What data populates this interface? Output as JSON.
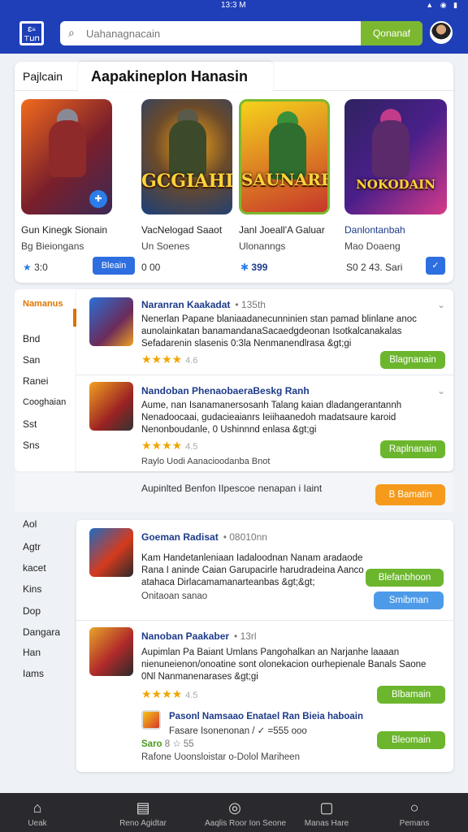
{
  "status_bar": {
    "time": "13:3 M",
    "icons": "signal wifi battery"
  },
  "header": {
    "logo_text": "Ɛ≡ ⊤⊔⊓",
    "search_placeholder": "Uahanagnacain",
    "search_button": "Qonanaf",
    "colors": {
      "bar": "#1f3fb8",
      "search_button": "#7cb82f"
    }
  },
  "featured": {
    "tab_label": "Pajlcain",
    "title": "AapakinepIon Hanasin",
    "cards": [
      {
        "art_text": "",
        "name": "Gun Kinegk Sionain",
        "sub": "Bg Bieiongans",
        "foot": "3:0",
        "action": "Bleain",
        "art_colors": [
          "#f26b1d",
          "#7a1f2b",
          "#3b2a55"
        ]
      },
      {
        "art_text": "GCGIAHI",
        "name": "VacNelogad Saaot",
        "sub": "Un Soenes",
        "foot": "0 00",
        "action": "",
        "art_colors": [
          "#1b3f7a",
          "#f0a21a",
          "#6b4a2a"
        ]
      },
      {
        "art_text": "SAUNARES",
        "name": "Janl Joeall'A Galuar",
        "sub": "Ulonanngs",
        "foot": "399",
        "action": "",
        "art_colors": [
          "#f5d21c",
          "#3a8f3a",
          "#c7372a"
        ]
      },
      {
        "art_text": "NOKODAIN",
        "name": "Danlontanbah",
        "sub": "Mao Doaeng",
        "foot": "S0 2 43. Sari",
        "action": "✓",
        "art_colors": [
          "#4a1f8a",
          "#d63a8a",
          "#2f2360"
        ]
      }
    ]
  },
  "sidebar_top": {
    "selected": "Namanus",
    "items": [
      "Bnd",
      "San",
      "Ranei",
      "Cooghaian",
      "Sst",
      "Sns"
    ]
  },
  "list_top": [
    {
      "title": "Naranran Kaakadat",
      "meta": "• 135th",
      "desc": "Nenerlan Papane blaniaadanecunninien stan pamad blinlane anoc aunolainkatan banamandanaSacaedgdeonan Isotkalcanakalas Sefadarenin slasenis 0:3la Nenmanendlrasa &gt;gi",
      "stars": "★★★★",
      "rating": "4.6",
      "action": "Blagnanain",
      "thumb_colors": [
        "#2a6fd6",
        "#6b2b5a"
      ]
    },
    {
      "title": "Nandoban PhenaobaeraBeskg Ranh",
      "meta": "",
      "desc": "Aume, nan Isanamanersosanh Talang kaian dladangerantannh Nenadoocaai, gudacieaianrs Ieiihaanedoh madatsaure karoid Nenonboudanle, 0 Ushinnnd enlasa &gt;gi",
      "stars": "★★★★",
      "rating": "4.5",
      "extra": "Raylo Uodi Aanacioodanba Bnot",
      "action": "Raplnanain",
      "thumb_colors": [
        "#f1a020",
        "#9b2222"
      ]
    }
  ],
  "promo_line": {
    "text": "Aupinlted Benfon IIpescoe nenapan i Iaint",
    "action": "B Bamatin"
  },
  "sidebar_bottom": {
    "items": [
      "Aol",
      "Agtr",
      "kacet",
      "Kins",
      "Dop",
      "Dangara",
      "Han",
      "Iams"
    ]
  },
  "list_bottom": [
    {
      "title": "Goeman Radisat",
      "meta": "• 08010nn",
      "desc": "Kam Handetanleniaan Iadaloodnan Nanam aradaode Rana I aninde Caian Garupacirle harudradeina Aanco atahaca Dirlacamamanarteanbas &gt;&gt;",
      "extra": "Onitaoan sanao",
      "action": "Blefanbhoon",
      "action2": "Smibman",
      "thumb_colors": [
        "#d53a1e",
        "#1f6bc2"
      ]
    },
    {
      "title": "Nanoban Paakaber",
      "meta": "• 13rl",
      "desc": "Aupimlan Pa Baiant Umlans Pangohalkan an Narjanhe laaaan nienuneienon/onoatine sont olonekacion ourhepienale Banals Saone 0Nl Nanmanenarases &gt;gi",
      "stars": "★★★★",
      "rating": "4.5",
      "action": "Blbamain",
      "sub_title": "Pasonl Namsaao Enatael Ran Bieia haboain",
      "sub_desc": "Fasare Isonenonan / ✓ =555 ooo",
      "sub_stars": "Saro",
      "sub_rating": "8 ☆ 55",
      "extra": "Rafone Uoonsloistar o-Dolol Mariheen",
      "action2": "Bleomain",
      "thumb_colors": [
        "#b02a2a",
        "#e8a52a"
      ]
    }
  ],
  "bottom_nav": [
    {
      "icon": "home-icon",
      "glyph": "⌂",
      "label": "Ueak"
    },
    {
      "icon": "list-icon",
      "glyph": "▤",
      "label": "Reno Agidtar"
    },
    {
      "icon": "check-circle-icon",
      "glyph": "◎",
      "label": "Aaqlis Roor Ion Seone"
    },
    {
      "icon": "message-icon",
      "glyph": "▢",
      "label": "Manas Hare"
    },
    {
      "icon": "profile-icon",
      "glyph": "○",
      "label": "Pemans"
    }
  ]
}
